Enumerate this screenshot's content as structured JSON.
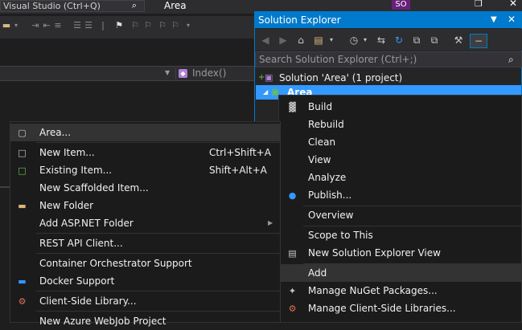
{
  "titlebar": {
    "search_text": "Visual Studio (Ctrl+Q)",
    "project_title": "Area",
    "user_initials": "SO"
  },
  "navbar": {
    "method_label": "Index()"
  },
  "solution_explorer": {
    "title": "Solution Explorer",
    "search_placeholder": "Search Solution Explorer (Ctrl+;)",
    "solution_label": "Solution 'Area' (1 project)",
    "project_label": "Area"
  },
  "context_menu": {
    "items": [
      {
        "label": "Build",
        "icon": "build-icon"
      },
      {
        "label": "Rebuild",
        "icon": ""
      },
      {
        "label": "Clean",
        "icon": ""
      },
      {
        "label": "View",
        "icon": ""
      },
      {
        "label": "Analyze",
        "icon": ""
      },
      {
        "label": "Publish...",
        "icon": "globe-icon"
      },
      {
        "label": "Overview",
        "icon": ""
      },
      {
        "label": "Scope to This",
        "icon": ""
      },
      {
        "label": "New Solution Explorer View",
        "icon": "new-view-icon"
      },
      {
        "label": "Add",
        "icon": ""
      },
      {
        "label": "Manage NuGet Packages...",
        "icon": "nuget-icon"
      },
      {
        "label": "Manage Client-Side Libraries...",
        "icon": "client-lib-icon"
      }
    ]
  },
  "add_menu": {
    "items": [
      {
        "label": "Area...",
        "shortcut": ""
      },
      {
        "label": "New Item...",
        "shortcut": "Ctrl+Shift+A"
      },
      {
        "label": "Existing Item...",
        "shortcut": "Shift+Alt+A"
      },
      {
        "label": "New Scaffolded Item...",
        "shortcut": ""
      },
      {
        "label": "New Folder",
        "shortcut": ""
      },
      {
        "label": "Add ASP.NET Folder",
        "shortcut": ""
      },
      {
        "label": "REST API Client...",
        "shortcut": ""
      },
      {
        "label": "Container Orchestrator Support",
        "shortcut": ""
      },
      {
        "label": "Docker Support",
        "shortcut": ""
      },
      {
        "label": "Client-Side Library...",
        "shortcut": ""
      },
      {
        "label": "New Azure WebJob Project",
        "shortcut": ""
      }
    ]
  },
  "colors": {
    "accent": "#007acc",
    "selection": "#3399ff",
    "menu_bg": "#1b1b1c",
    "menu_highlight": "#333334"
  }
}
